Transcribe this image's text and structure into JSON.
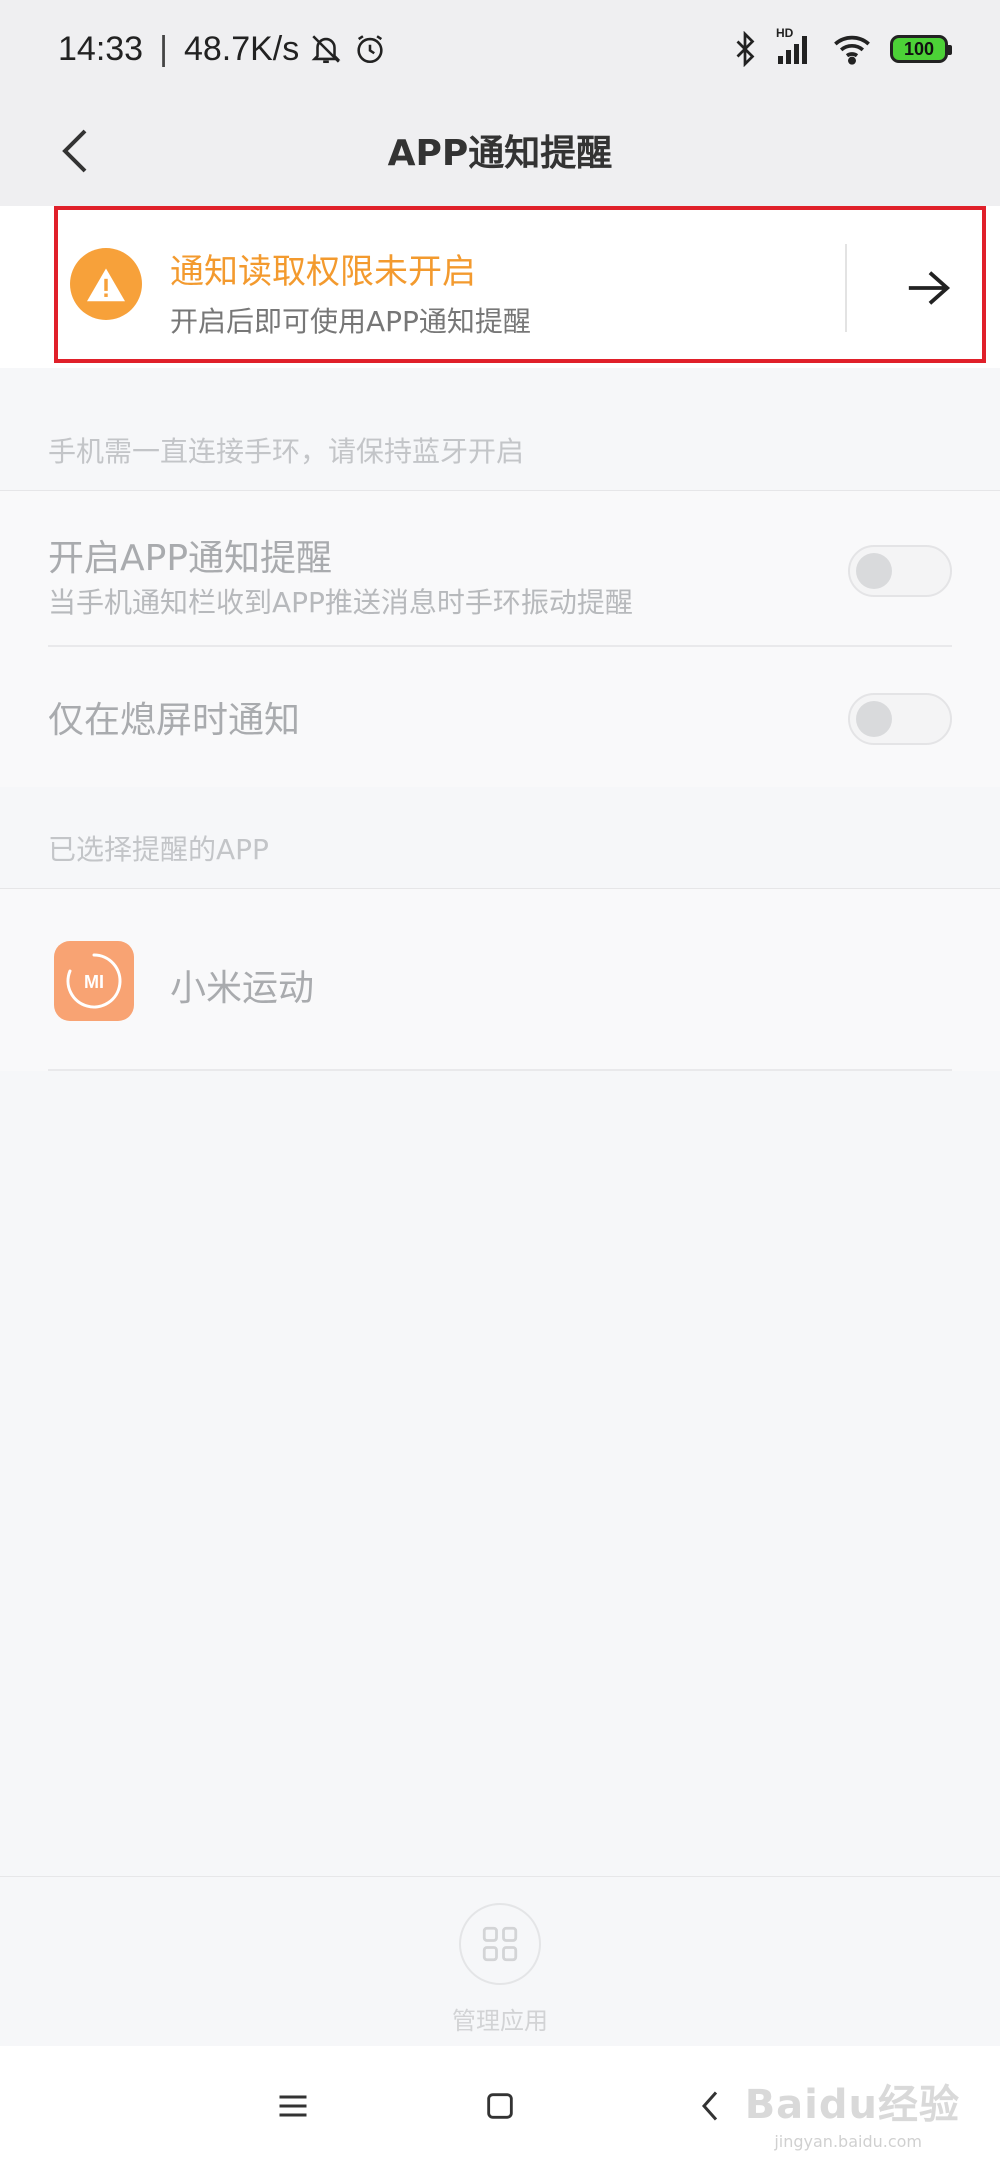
{
  "status_bar": {
    "time": "14:33",
    "speed": "48.7K/s",
    "signal_label": "HD",
    "battery": "100"
  },
  "header": {
    "title": "APP通知提醒"
  },
  "permission_alert": {
    "title": "通知读取权限未开启",
    "subtitle": "开启后即可使用APP通知提醒"
  },
  "hint": "手机需一直连接手环，请保持蓝牙开启",
  "settings": [
    {
      "title": "开启APP通知提醒",
      "subtitle": "当手机通知栏收到APP推送消息时手环振动提醒",
      "enabled": false
    },
    {
      "title": "仅在熄屏时通知",
      "enabled": false
    }
  ],
  "selected_section_label": "已选择提醒的APP",
  "selected_apps": [
    {
      "name": "小米运动",
      "icon_text": "MI"
    }
  ],
  "bottom": {
    "manage_label": "管理应用"
  },
  "watermark": {
    "text": "Baidu经验",
    "sub": "jingyan.baidu.com"
  },
  "colors": {
    "accent_orange": "#f39a2e",
    "highlight_red": "#e0202a",
    "app_icon": "#f8a373"
  }
}
